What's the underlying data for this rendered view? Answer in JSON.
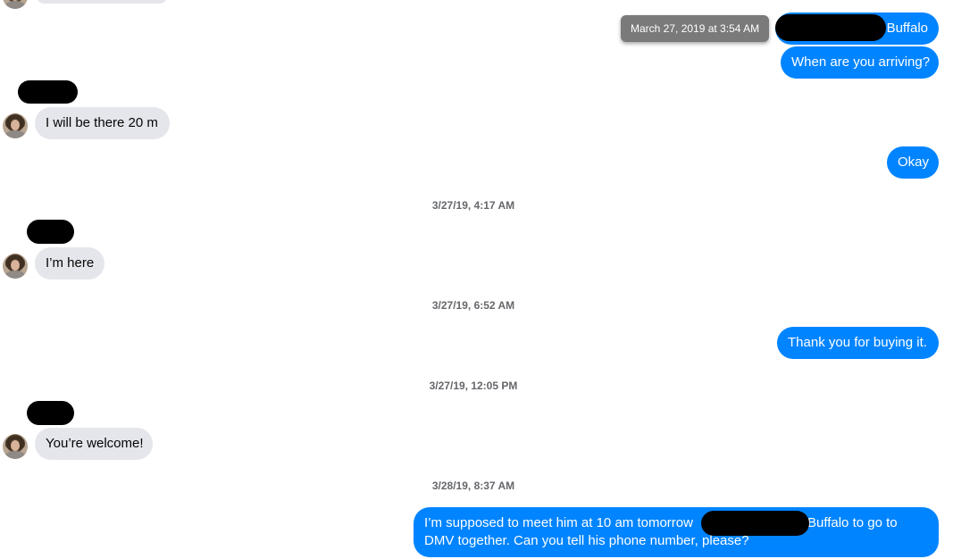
{
  "tooltip": {
    "text": "March 27, 2019 at 3:54 AM"
  },
  "timestamps": [
    "3/27/19, 4:17 AM",
    "3/27/19, 6:52 AM",
    "3/27/19, 12:05 PM",
    "3/28/19, 8:37 AM"
  ],
  "messages": {
    "m1_suffix": "Buffalo",
    "m2": "When are you arriving?",
    "m3": "I will be there 20 m",
    "m4": "Okay",
    "m5": "I’m here",
    "m6": "Thank you for buying it.",
    "m7": "You’re welcome!",
    "m8_part1": "I’m supposed to meet him at 10 am tomorrow",
    "m8_part2": "Buffalo to go to",
    "m8_line2": "DMV together. Can you tell his phone number, please?"
  },
  "colors": {
    "outgoing": "#0084ff",
    "incoming": "#e4e6eb",
    "tooltip": "#7a7a7a",
    "timestamp": "#65676b"
  }
}
